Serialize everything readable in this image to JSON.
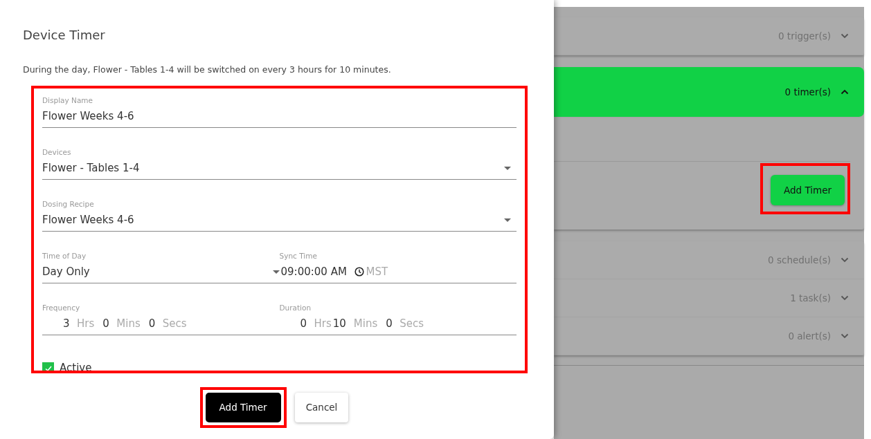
{
  "dialog": {
    "title": "Device Timer",
    "description": "During the day, Flower - Tables 1-4 will be switched on every 3 hours for 10 minutes.",
    "fields": [
      {
        "kind": "text",
        "label": "Display Name",
        "value": "Flower Weeks 4-6"
      },
      {
        "kind": "select",
        "label": "Devices",
        "value": "Flower - Tables 1-4"
      },
      {
        "kind": "select",
        "label": "Dosing Recipe",
        "value": "Flower Weeks 4-6"
      }
    ],
    "time_of_day": {
      "label": "Time of Day",
      "value": "Day Only"
    },
    "sync_time": {
      "label": "Sync Time",
      "value": "09:00:00 AM",
      "timezone": "MST"
    },
    "frequency": {
      "label": "Frequency",
      "parts": [
        {
          "value": "3",
          "unit": "Hrs"
        },
        {
          "value": "0",
          "unit": "Mins"
        },
        {
          "value": "0",
          "unit": "Secs"
        }
      ]
    },
    "duration": {
      "label": "Duration",
      "parts": [
        {
          "value": "0",
          "unit": "Hrs"
        },
        {
          "value": "10",
          "unit": "Mins"
        },
        {
          "value": "0",
          "unit": "Secs"
        }
      ]
    },
    "active": {
      "label": "Active",
      "checked": true
    },
    "buttons": [
      {
        "label": "Add Timer",
        "kind": "primary",
        "highlighted": true
      },
      {
        "label": "Cancel",
        "kind": "secondary",
        "highlighted": false
      }
    ]
  },
  "background": {
    "groups": [
      [
        {
          "label": "0 trigger(s)",
          "expanded": false
        }
      ],
      [
        {
          "label": "0 timer(s)",
          "expanded": true,
          "button": "Add Timer"
        }
      ],
      [
        {
          "label": "0 schedule(s)",
          "expanded": false
        },
        {
          "label": "1 task(s)",
          "expanded": false
        },
        {
          "label": "0 alert(s)",
          "expanded": false
        }
      ]
    ]
  }
}
